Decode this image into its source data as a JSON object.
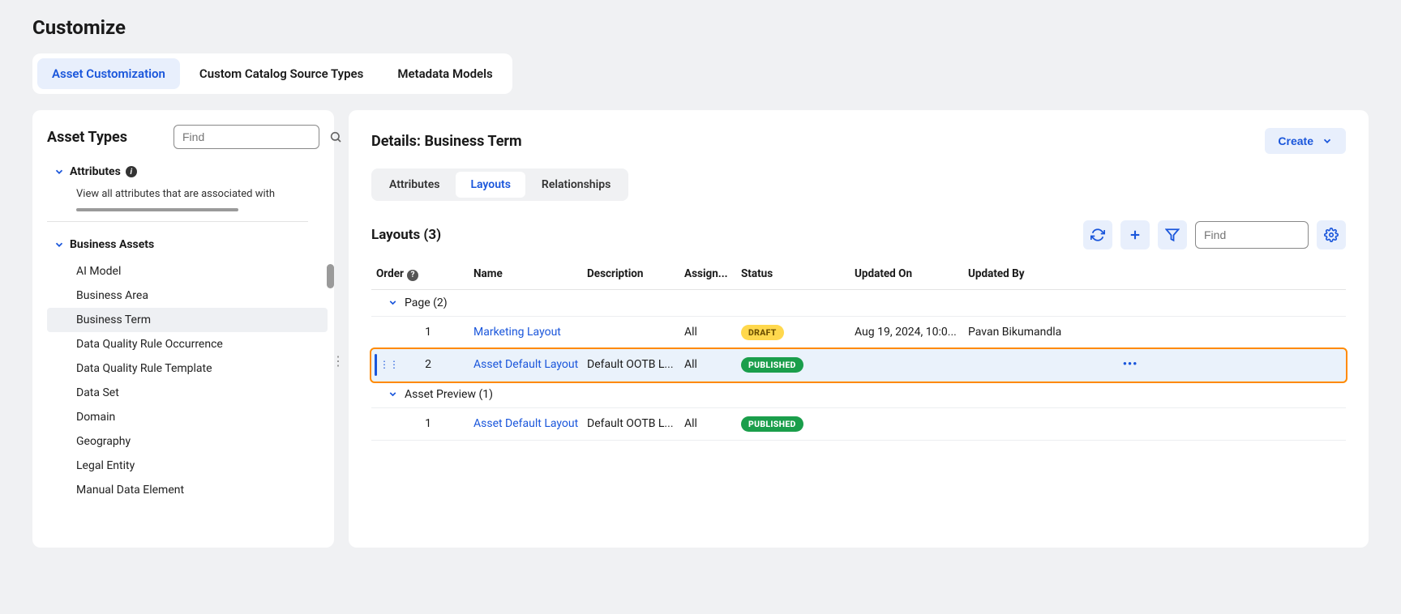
{
  "page_title": "Customize",
  "top_tabs": [
    {
      "label": "Asset Customization",
      "active": true
    },
    {
      "label": "Custom Catalog Source Types",
      "active": false
    },
    {
      "label": "Metadata Models",
      "active": false
    }
  ],
  "sidebar": {
    "title": "Asset Types",
    "search_placeholder": "Find",
    "attributes": {
      "label": "Attributes",
      "description": "View all attributes that are associated with"
    },
    "group": {
      "label": "Business Assets",
      "items": [
        "AI Model",
        "Business Area",
        "Business Term",
        "Data Quality Rule Occurrence",
        "Data Quality Rule Template",
        "Data Set",
        "Domain",
        "Geography",
        "Legal Entity",
        "Manual Data Element"
      ],
      "selected_index": 2
    }
  },
  "details": {
    "title": "Details: Business Term",
    "create_label": "Create",
    "subtabs": [
      {
        "label": "Attributes",
        "active": false
      },
      {
        "label": "Layouts",
        "active": true
      },
      {
        "label": "Relationships",
        "active": false
      }
    ]
  },
  "layouts": {
    "title": "Layouts (3)",
    "find_placeholder": "Find",
    "columns": {
      "order": "Order",
      "name": "Name",
      "description": "Description",
      "assign": "Assign...",
      "status": "Status",
      "updated_on": "Updated On",
      "updated_by": "Updated By"
    },
    "groups": [
      {
        "label": "Page (2)",
        "rows": [
          {
            "order": "1",
            "name": "Marketing Layout",
            "description": "",
            "assign": "All",
            "status": "DRAFT",
            "status_class": "draft",
            "updated_on": "Aug 19, 2024, 10:0...",
            "updated_by": "Pavan Bikumandla",
            "highlighted": false
          },
          {
            "order": "2",
            "name": "Asset Default Layout",
            "description": "Default OOTB L...",
            "assign": "All",
            "status": "PUBLISHED",
            "status_class": "published",
            "updated_on": "",
            "updated_by": "",
            "highlighted": true
          }
        ]
      },
      {
        "label": "Asset Preview (1)",
        "rows": [
          {
            "order": "1",
            "name": "Asset Default Layout",
            "description": "Default OOTB L...",
            "assign": "All",
            "status": "PUBLISHED",
            "status_class": "published",
            "updated_on": "",
            "updated_by": "",
            "highlighted": false
          }
        ]
      }
    ]
  }
}
